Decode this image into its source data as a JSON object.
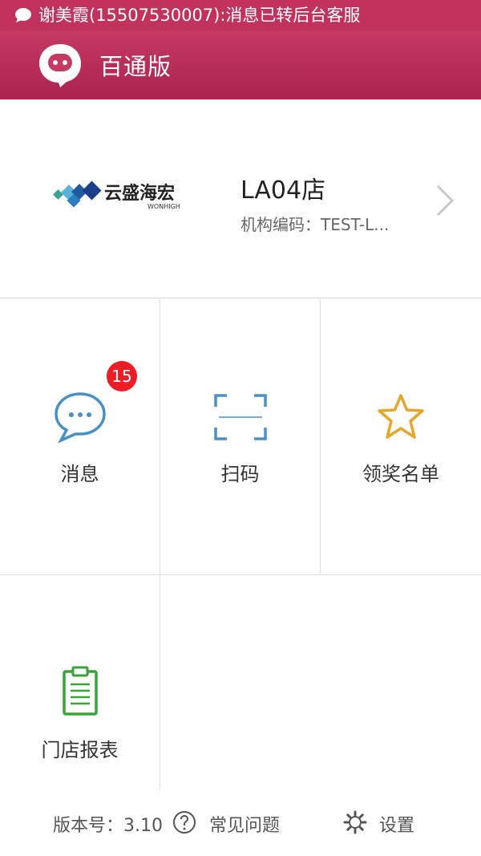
{
  "status_bar": {
    "notification_text": "谢美霞(15507530007):消息已转后台客服",
    "icon": "chat-bubble-icon"
  },
  "app_bar": {
    "title": "百通版",
    "logo_icon": "chat-logo-icon"
  },
  "store": {
    "brand_cn": "云盛海宏",
    "brand_en": "WONHIGH",
    "name": "LA04店",
    "code_label": "机构编码：TEST-L..."
  },
  "grid": {
    "items": [
      {
        "label": "消息",
        "icon": "message-bubble-icon",
        "badge": "15"
      },
      {
        "label": "扫码",
        "icon": "scan-icon"
      },
      {
        "label": "领奖名单",
        "icon": "star-icon"
      },
      {
        "label": "门店报表",
        "icon": "clipboard-report-icon"
      }
    ]
  },
  "footer": {
    "version": "版本号：3.10",
    "faq_label": "常见问题",
    "faq_icon": "question-circle-icon",
    "settings_label": "设置",
    "settings_icon": "gear-icon"
  },
  "colors": {
    "brand": "#c2325c",
    "badge": "#ee1c25",
    "message_icon": "#4a90c8",
    "star_icon": "#e8a628",
    "report_icon": "#3aa33a"
  }
}
